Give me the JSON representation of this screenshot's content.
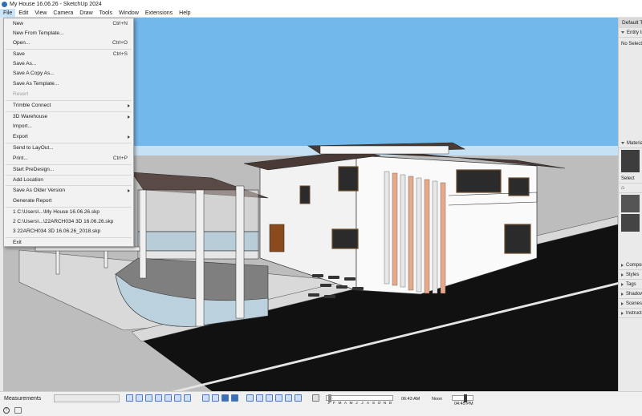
{
  "window": {
    "title": "My House 16.06.26 - SketchUp 2024"
  },
  "menubar": {
    "items": [
      "File",
      "Edit",
      "View",
      "Camera",
      "Draw",
      "Tools",
      "Window",
      "Extensions",
      "Help"
    ]
  },
  "file_menu": {
    "new": {
      "label": "New",
      "shortcut": "Ctrl+N"
    },
    "new_from_template": {
      "label": "New From Template..."
    },
    "open": {
      "label": "Open...",
      "shortcut": "Ctrl+O"
    },
    "save": {
      "label": "Save",
      "shortcut": "Ctrl+S"
    },
    "save_as": {
      "label": "Save As..."
    },
    "save_copy_as": {
      "label": "Save A Copy As..."
    },
    "save_as_template": {
      "label": "Save As Template..."
    },
    "revert": {
      "label": "Revert"
    },
    "trimble_connect": {
      "label": "Trimble Connect"
    },
    "warehouse": {
      "label": "3D Warehouse"
    },
    "import": {
      "label": "Import..."
    },
    "export": {
      "label": "Export"
    },
    "send_to_layout": {
      "label": "Send to LayOut..."
    },
    "print": {
      "label": "Print...",
      "shortcut": "Ctrl+P"
    },
    "start_predesign": {
      "label": "Start PreDesign..."
    },
    "add_location": {
      "label": "Add Location"
    },
    "save_older": {
      "label": "Save As Older Version"
    },
    "generate_report": {
      "label": "Generate Report"
    },
    "recent_1": {
      "label": "1 C:\\Users\\...\\My House 16.06.26.skp"
    },
    "recent_2": {
      "label": "2 C:\\Users\\...\\22ARCH034 3D 16.06.26.skp"
    },
    "recent_3": {
      "label": "3 22ARCH034 3D 16.06.26_2018.skp"
    },
    "exit": {
      "label": "Exit"
    }
  },
  "right_panel": {
    "title": "Default Tray",
    "entity_info": "Entity Info",
    "no_selection": "No Selection",
    "materials": "Materials",
    "select_tab": "Select",
    "collapsed": [
      "Components",
      "Styles",
      "Tags",
      "Shadows",
      "Scenes",
      "Instructor"
    ]
  },
  "statusbar": {
    "measurements_label": "Measurements",
    "months": [
      "J",
      "F",
      "M",
      "A",
      "M",
      "J",
      "J",
      "A",
      "S",
      "O",
      "N",
      "D"
    ],
    "time_start": "06:43 AM",
    "time_noon": "Noon",
    "time_end": "04:45 PM"
  }
}
